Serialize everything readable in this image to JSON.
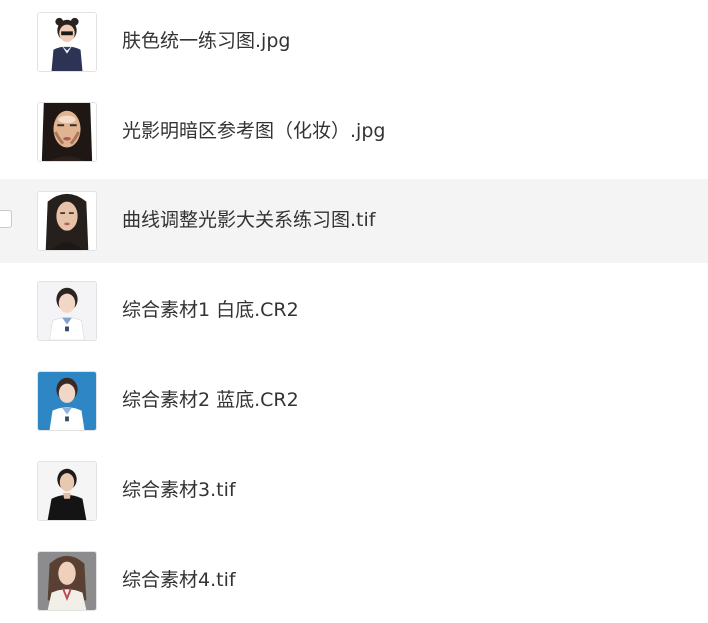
{
  "files": [
    {
      "name": "肤色统一练习图.jpg",
      "thumbnail": "child-portrait-thumbnail",
      "background": "#ffffff"
    },
    {
      "name": "光影明暗区参考图（化妆）.jpg",
      "thumbnail": "makeup-face-thumbnail",
      "background": "#ffffff"
    },
    {
      "name": "曲线调整光影大关系练习图.tif",
      "thumbnail": "woman-portrait-thumbnail",
      "background": "#ffffff"
    },
    {
      "name": "综合素材1 白底.CR2",
      "thumbnail": "student-white-background-thumbnail",
      "background": "#f4f4f6"
    },
    {
      "name": "综合素材2 蓝底.CR2",
      "thumbnail": "student-blue-background-thumbnail",
      "background": "#2f86c4"
    },
    {
      "name": "综合素材3.tif",
      "thumbnail": "woman-black-top-thumbnail",
      "background": "#f5f5f5"
    },
    {
      "name": "综合素材4.tif",
      "thumbnail": "woman-gray-background-thumbnail",
      "background": "#8c8b8d"
    }
  ],
  "hovered_row": 2,
  "colors": {
    "row_hover": "#f4f4f4",
    "text": "#333333",
    "thumb_border": "#e2e2e2"
  }
}
